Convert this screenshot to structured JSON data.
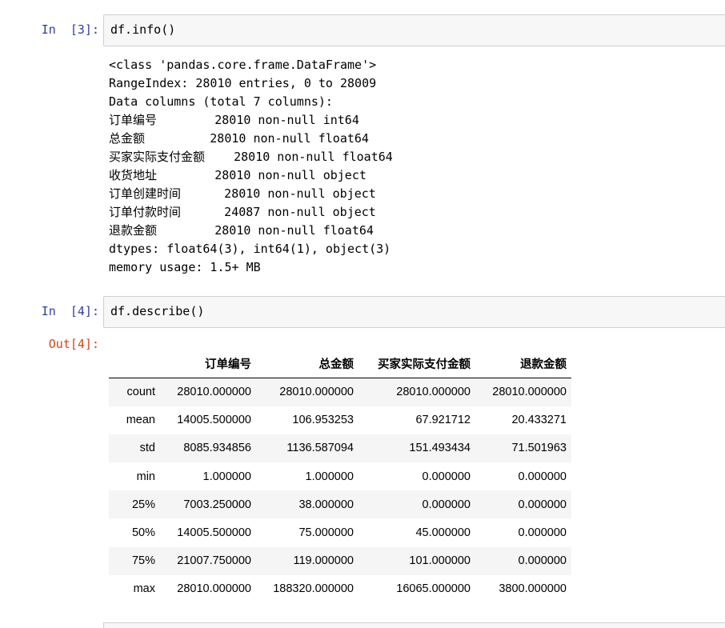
{
  "cells": [
    {
      "prompt": "In  [3]:",
      "code": "df.info()",
      "output_lines": [
        "<class 'pandas.core.frame.DataFrame'>",
        "RangeIndex: 28010 entries, 0 to 28009",
        "Data columns (total 7 columns):",
        "订单编号        28010 non-null int64",
        "总金额         28010 non-null float64",
        "买家实际支付金额    28010 non-null float64",
        "收货地址        28010 non-null object",
        "订单创建时间      28010 non-null object",
        "订单付款时间      24087 non-null object",
        "退款金额        28010 non-null float64",
        "dtypes: float64(3), int64(1), object(3)",
        "memory usage: 1.5+ MB"
      ]
    },
    {
      "prompt": "In  [4]:",
      "code": "df.describe()",
      "out_prompt": "Out[4]:",
      "table": {
        "columns": [
          "",
          "订单编号",
          "总金额",
          "买家实际支付金额",
          "退款金额"
        ],
        "rows": [
          [
            "count",
            "28010.000000",
            "28010.000000",
            "28010.000000",
            "28010.000000"
          ],
          [
            "mean",
            "14005.500000",
            "106.953253",
            "67.921712",
            "20.433271"
          ],
          [
            "std",
            "8085.934856",
            "1136.587094",
            "151.493434",
            "71.501963"
          ],
          [
            "min",
            "1.000000",
            "1.000000",
            "0.000000",
            "0.000000"
          ],
          [
            "25%",
            "7003.250000",
            "38.000000",
            "0.000000",
            "0.000000"
          ],
          [
            "50%",
            "14005.500000",
            "75.000000",
            "45.000000",
            "0.000000"
          ],
          [
            "75%",
            "21007.750000",
            "119.000000",
            "101.000000",
            "0.000000"
          ],
          [
            "max",
            "28010.000000",
            "188320.000000",
            "16065.000000",
            "3800.000000"
          ]
        ]
      }
    }
  ],
  "colors": {
    "in_prompt": "#303f9f",
    "out_prompt": "#d84315",
    "input_bg": "#f7f7f7",
    "input_border": "#cfcfcf",
    "row_stripe": "#f5f5f5"
  }
}
